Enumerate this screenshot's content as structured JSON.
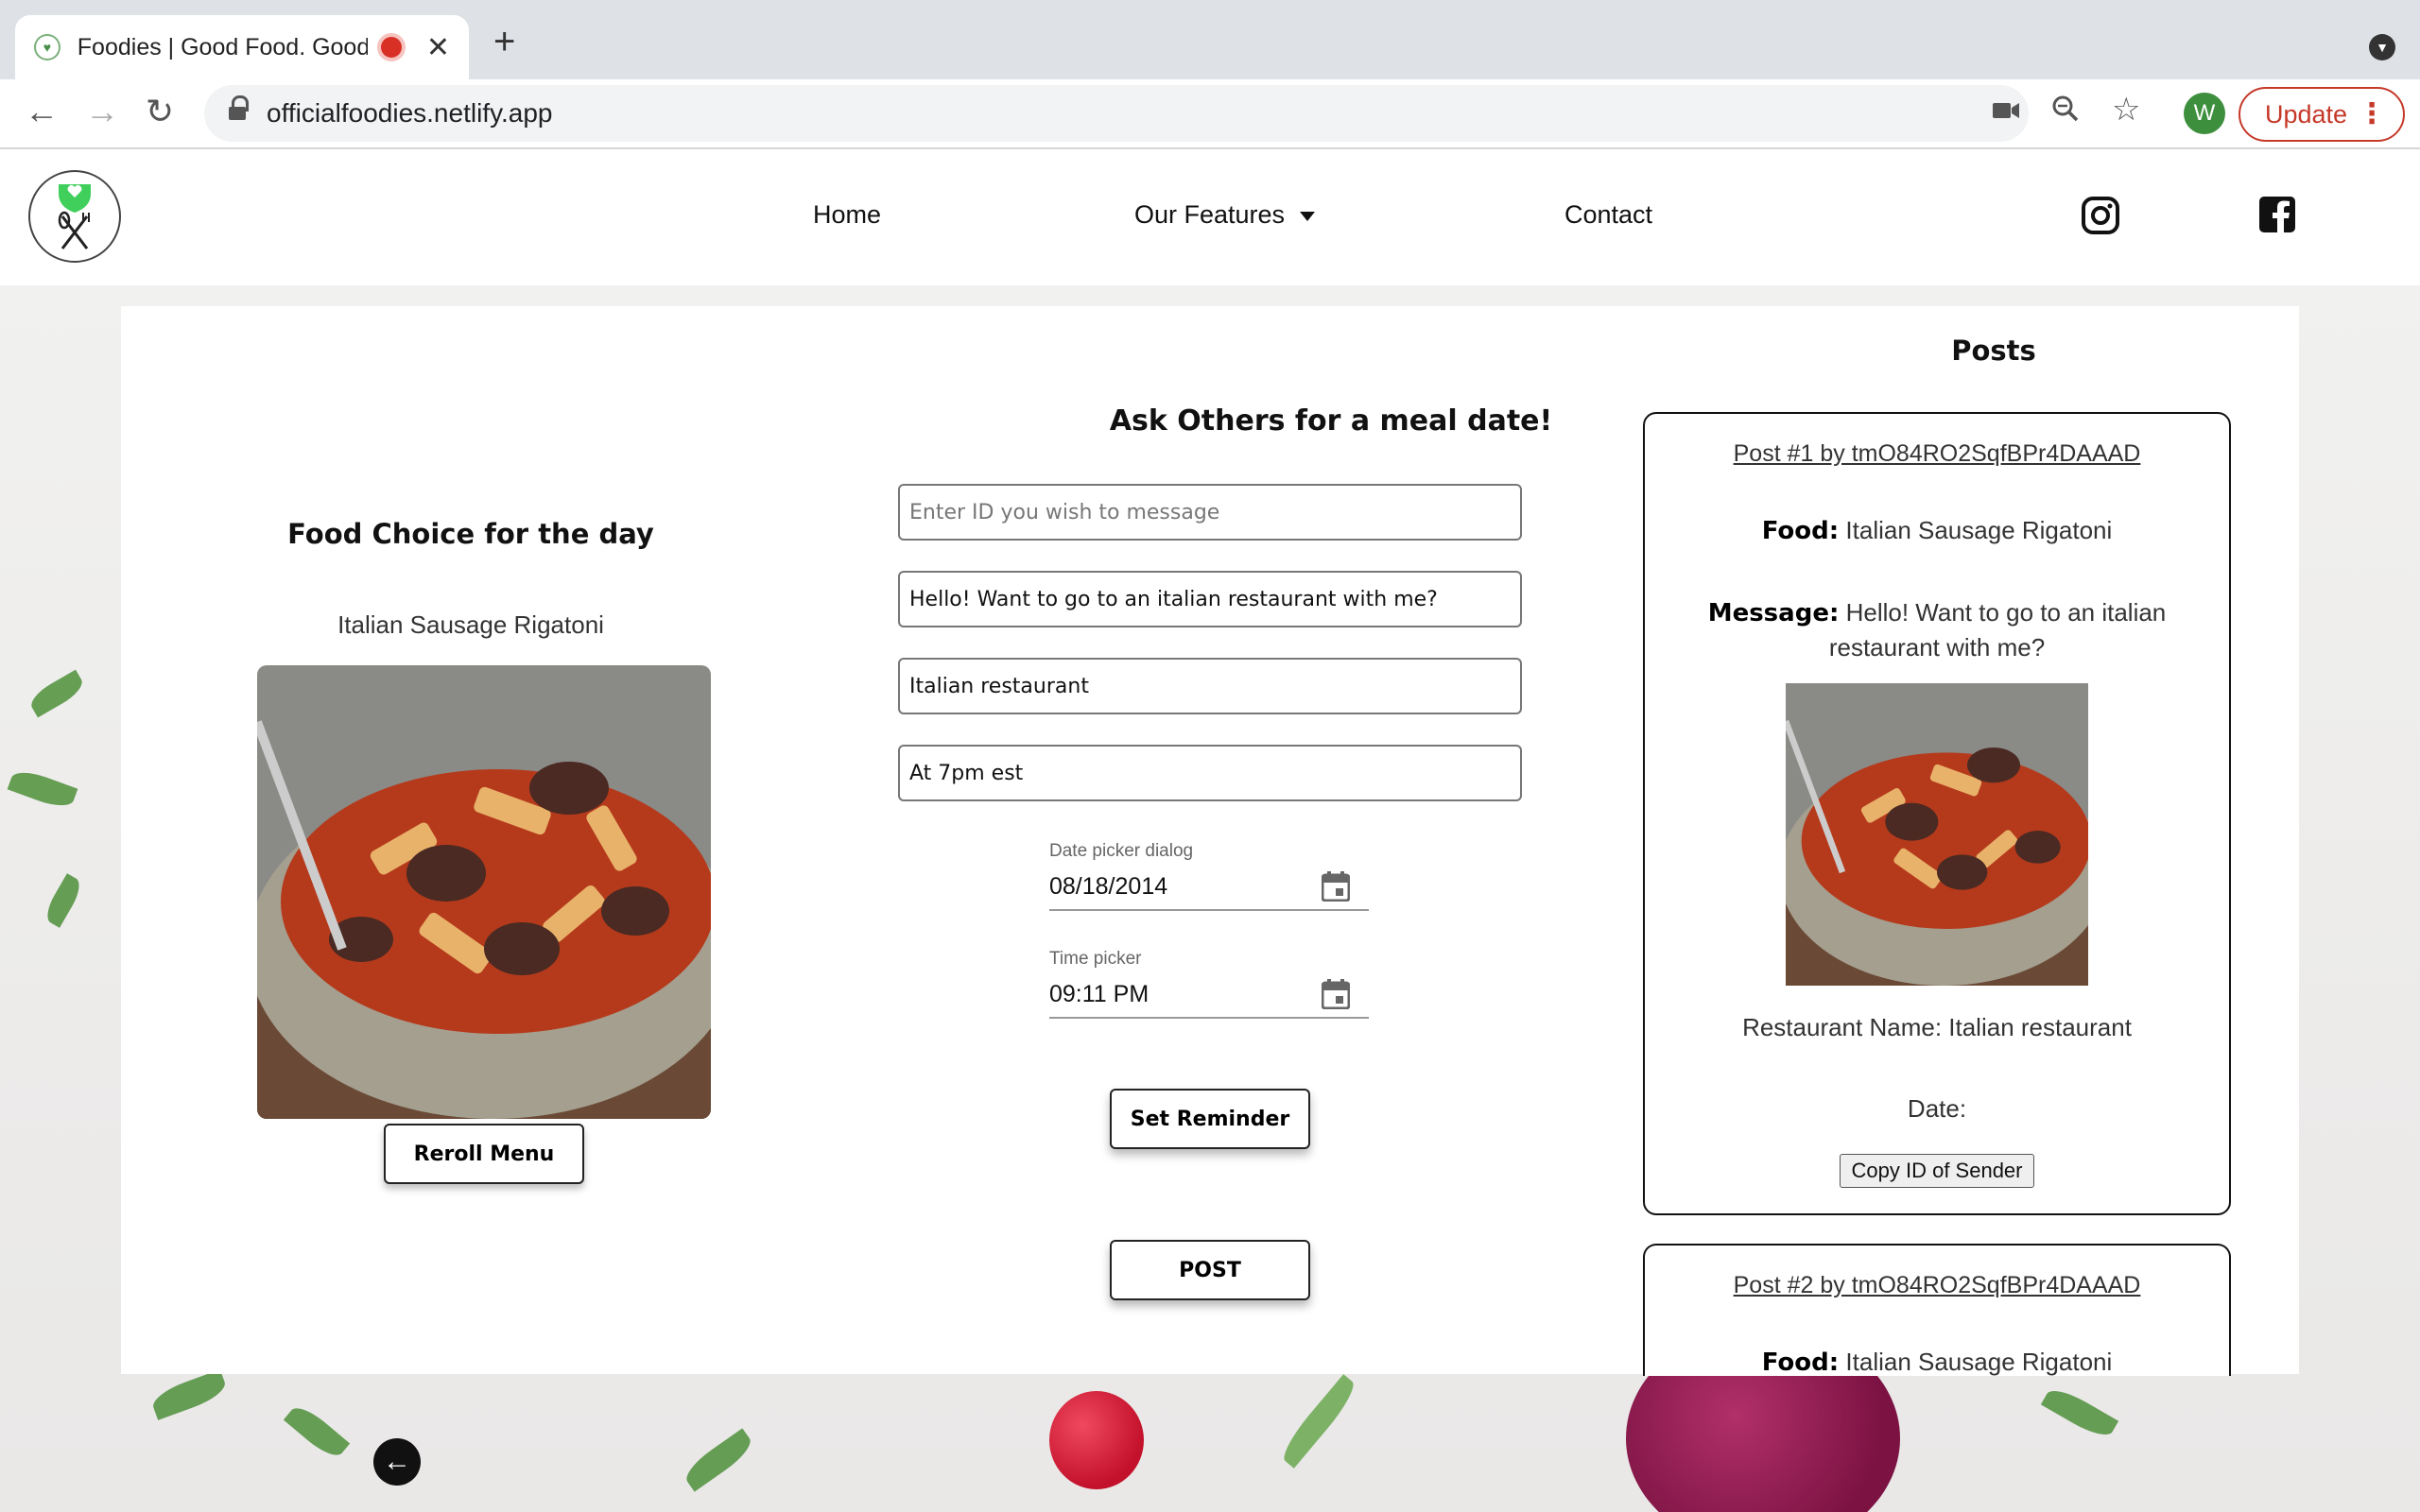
{
  "browser": {
    "tab_title": "Foodies | Good Food. Good",
    "url": "officialfoodies.netlify.app",
    "profile_initial": "W",
    "update_label": "Update",
    "accent": "#c53929"
  },
  "site": {
    "nav": {
      "home": "Home",
      "features": "Our Features",
      "contact": "Contact"
    }
  },
  "food_choice": {
    "title": "Food Choice for the day",
    "food_name": "Italian Sausage Rigatoni",
    "reroll_label": "Reroll Menu"
  },
  "meal_date": {
    "title": "Ask Others for a meal date!",
    "id_placeholder": "Enter ID you wish to message",
    "message_value": "Hello! Want to go to an italian restaurant with me?",
    "restaurant_value": "Italian restaurant",
    "time_note_value": "At 7pm est",
    "date_label": "Date picker dialog",
    "date_value": "08/18/2014",
    "time_label": "Time picker",
    "time_value": "09:11 PM",
    "reminder_label": "Set Reminder",
    "post_label": "POST"
  },
  "posts": {
    "title": "Posts",
    "food_label": "Food:",
    "message_label": "Message:",
    "items": [
      {
        "heading": "Post #1 by tmO84RO2SqfBPr4DAAAD",
        "food": "Italian Sausage Rigatoni",
        "message": "Hello! Want to go to an italian restaurant with me?",
        "restaurant": "Restaurant Name: Italian restaurant",
        "date": "Date:",
        "copy_label": "Copy ID of Sender"
      },
      {
        "heading": "Post #2 by tmO84RO2SqfBPr4DAAAD",
        "food": "Italian Sausage Rigatoni"
      }
    ]
  }
}
